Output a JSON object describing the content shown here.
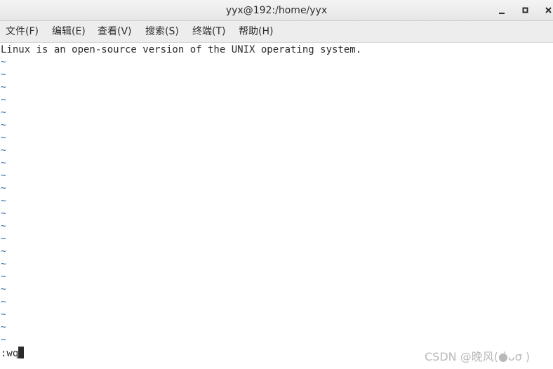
{
  "window": {
    "title": "yyx@192:/home/yyx"
  },
  "menu": [
    {
      "label": "文件(F)"
    },
    {
      "label": "编辑(E)"
    },
    {
      "label": "查看(V)"
    },
    {
      "label": "搜索(S)"
    },
    {
      "label": "终端(T)"
    },
    {
      "label": "帮助(H)"
    }
  ],
  "editor": {
    "lines": [
      "Linux is an open-source version of the UNIX operating system."
    ],
    "empty_line_marker": "~",
    "command": ":wq"
  },
  "watermark": "CSDN @晚风(●̀ᴗσ )",
  "colors": {
    "tilde": "#3465a4",
    "text": "#2b2b2b",
    "menubar": "#ededed"
  }
}
